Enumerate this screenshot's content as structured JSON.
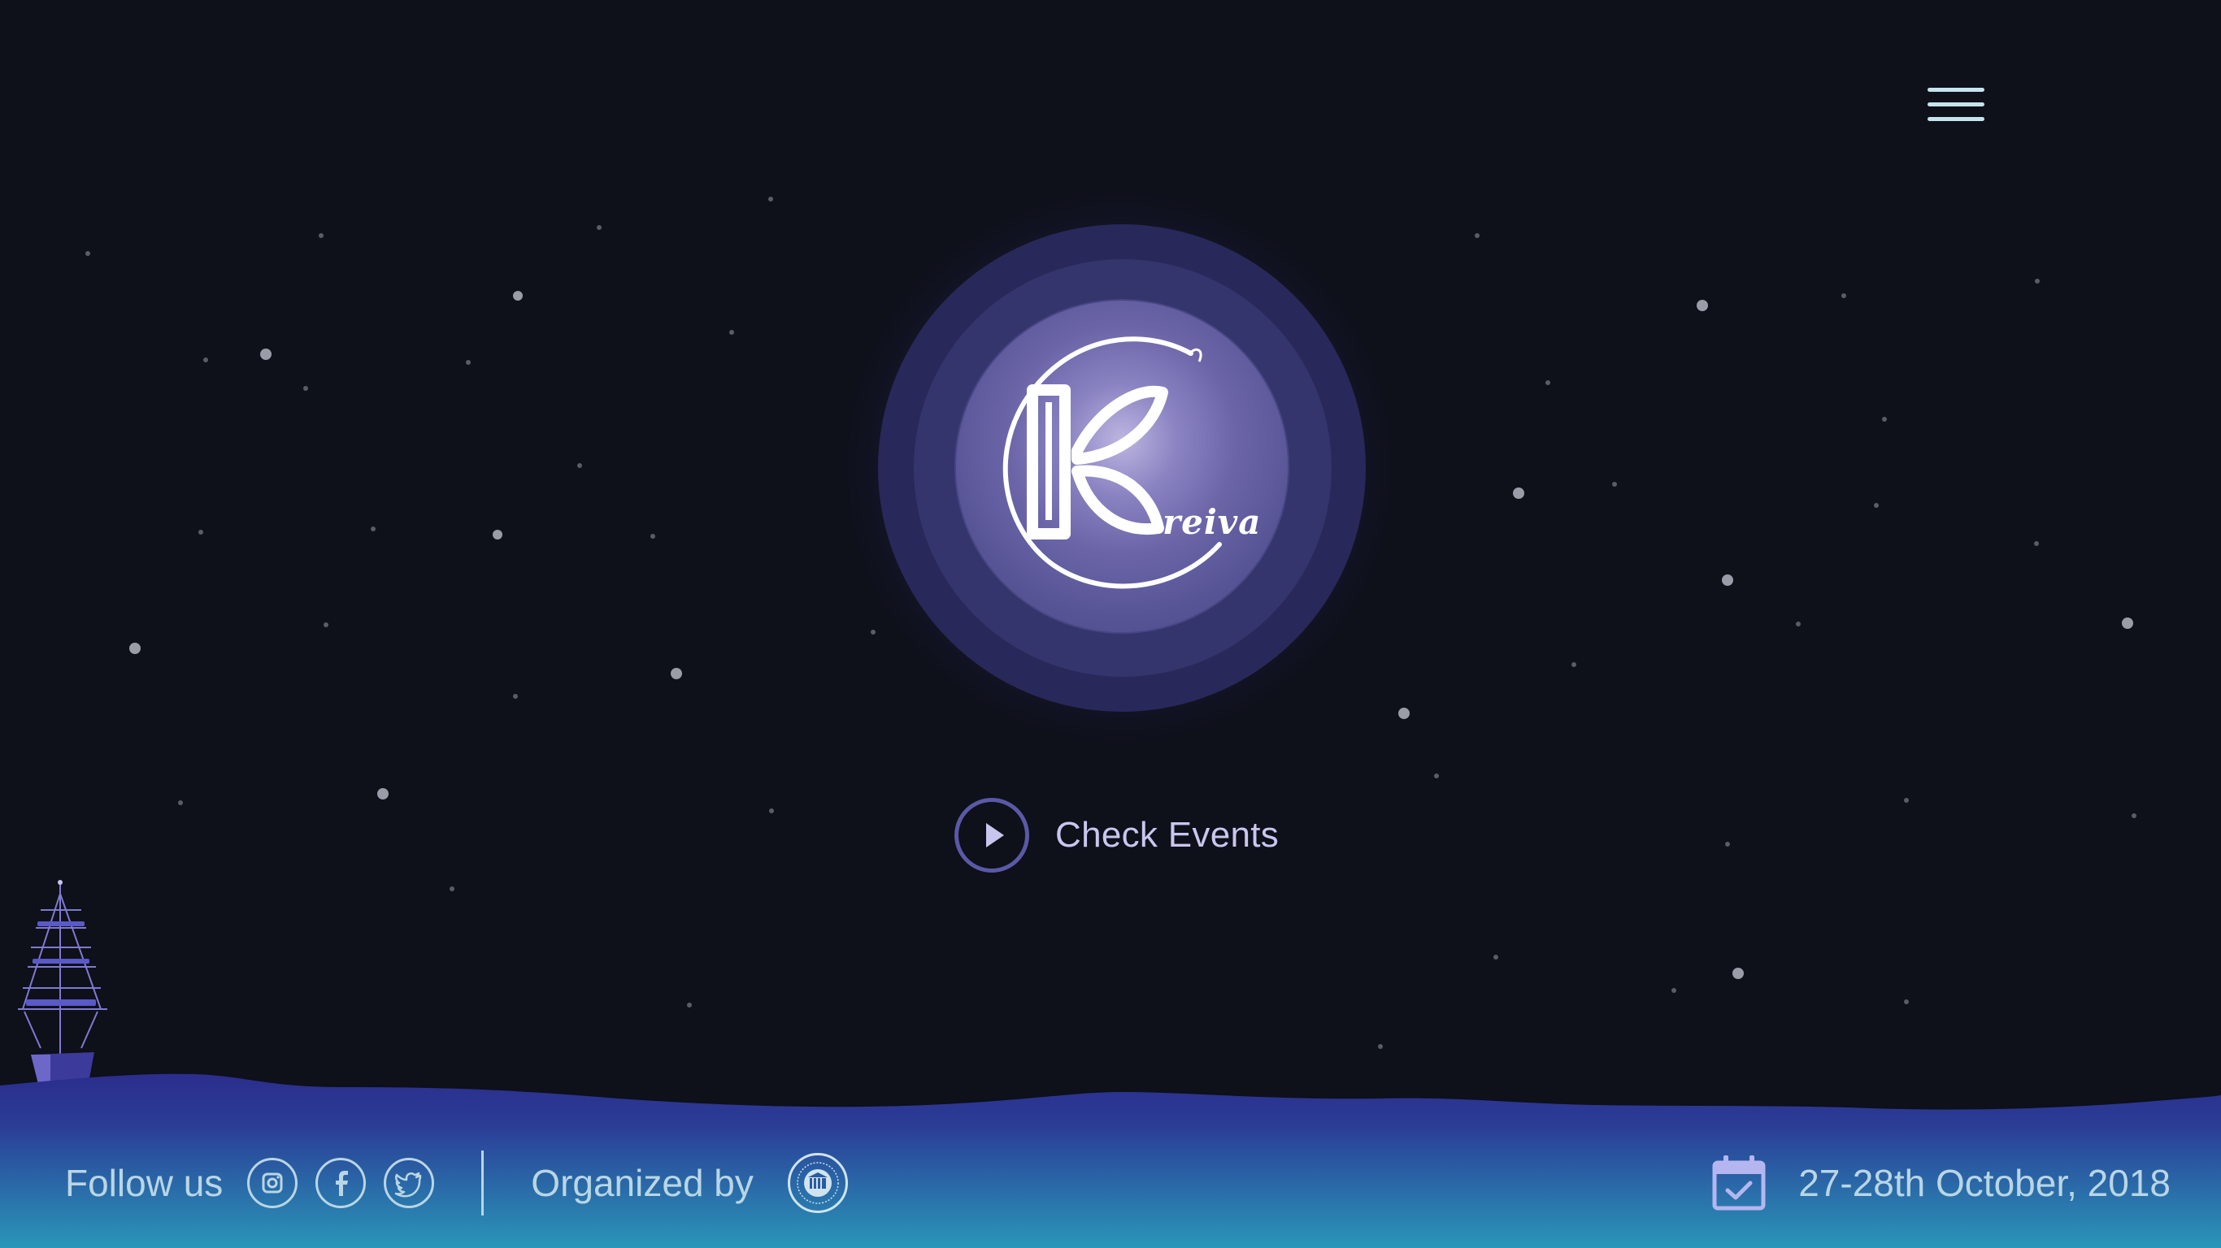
{
  "header": {
    "menu_icon": "hamburger-menu-icon"
  },
  "hero": {
    "logo_text": "reiva",
    "logo_icon": "kreiva-k-leaf-logo",
    "cta_label": "Check Events",
    "cta_icon": "play-circle-icon"
  },
  "footer": {
    "follow_label": "Follow us",
    "social": [
      {
        "name": "instagram",
        "icon": "instagram-icon"
      },
      {
        "name": "facebook",
        "icon": "facebook-icon"
      },
      {
        "name": "twitter",
        "icon": "twitter-icon"
      }
    ],
    "organized_label": "Organized by",
    "organizer_icon": "iiit-seal-icon",
    "calendar_icon": "calendar-check-icon",
    "date": "27-28th October, 2018"
  },
  "colors": {
    "background": "#0e101a",
    "ring_accent": "#5b58a6",
    "cta_text": "#c9c6ee",
    "footer_text": "#b9d6e4",
    "wave_dark": "#2a2f8e",
    "wave_light": "#2a93b8"
  }
}
